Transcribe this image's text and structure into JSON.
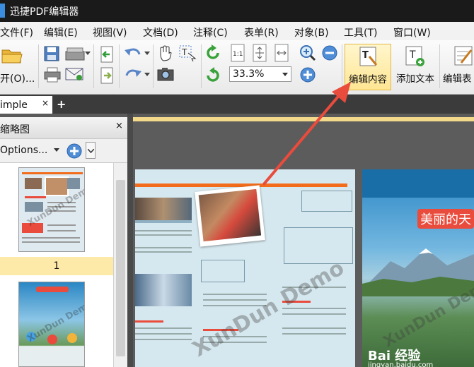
{
  "window": {
    "title": "迅捷PDF编辑器"
  },
  "menu": [
    "文件(F)",
    "编辑(E)",
    "视图(V)",
    "文档(D)",
    "注释(C)",
    "表单(R)",
    "对象(B)",
    "工具(T)",
    "窗口(W)"
  ],
  "toolbar": {
    "open_label": "开(O)...",
    "zoom_value": "33.3%",
    "edit_content_label": "编辑内容",
    "add_text_label": "添加文本",
    "edit_form_label": "编辑表"
  },
  "tabs": {
    "active_label": "imple"
  },
  "panel": {
    "title": "缩略图",
    "options_label": "Options...",
    "page_number": "1"
  },
  "document": {
    "headline": "美丽的天",
    "watermark": "XunDun Demo",
    "site_brand": "Bai 经验",
    "site_url": "jingyan.baidu.com"
  },
  "colors": {
    "accent": "#e94b3c",
    "active_button": "#ffe693",
    "page_orange": "#f26c1c"
  }
}
